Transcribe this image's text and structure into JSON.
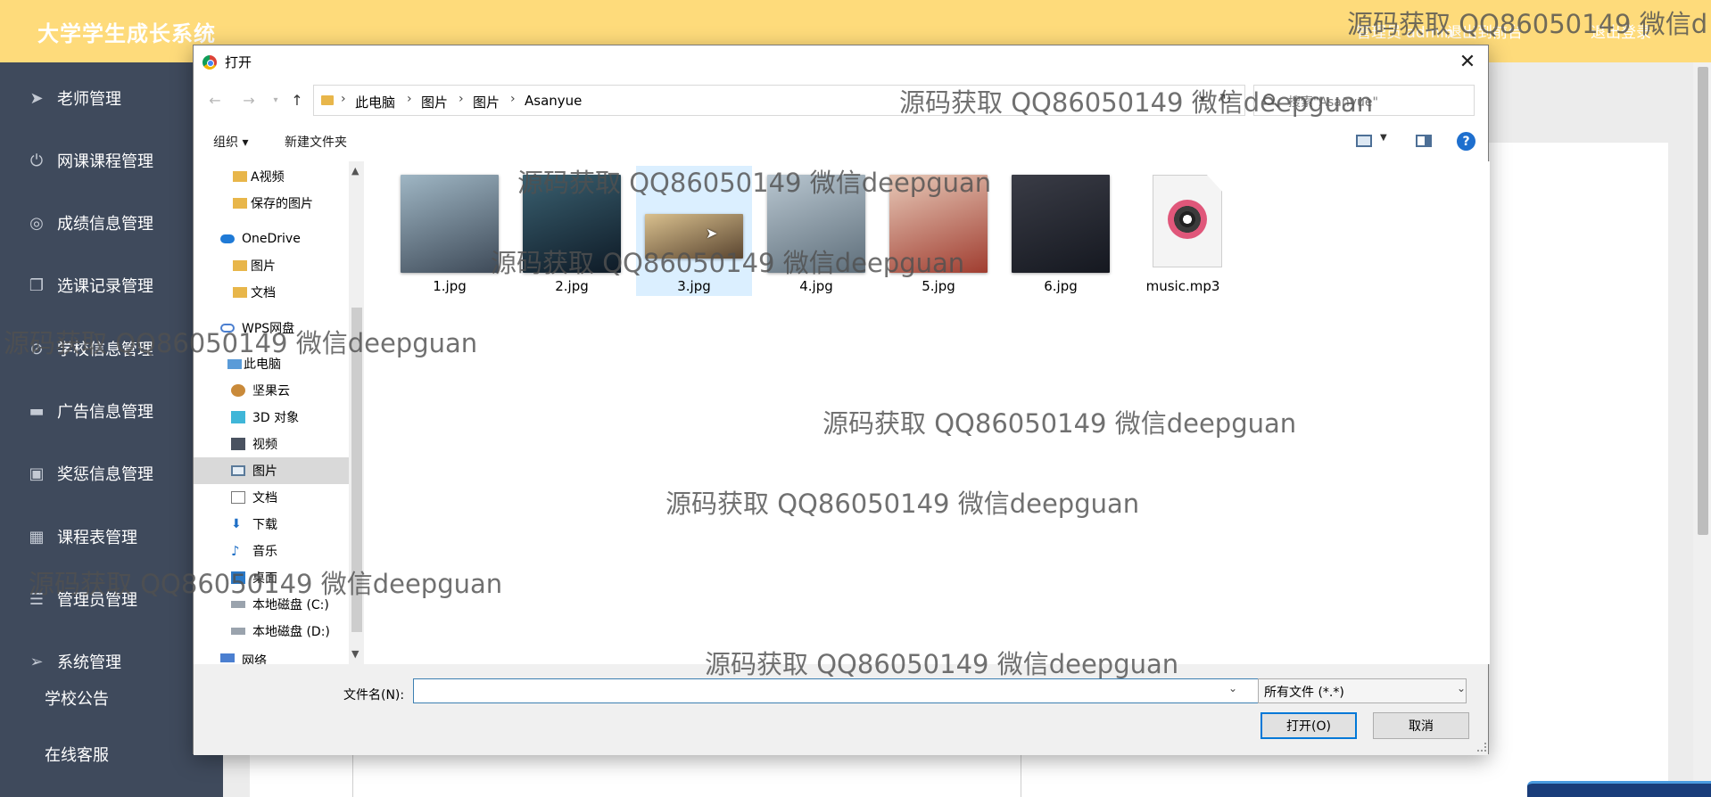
{
  "app": {
    "title": "大学学生成长系统",
    "top_links": [
      "管理员 admin",
      "退出到前台",
      "退出登录"
    ]
  },
  "sidebar": {
    "items": [
      {
        "label": "老师管理",
        "icon": "send-icon"
      },
      {
        "label": "网课课程管理",
        "icon": "power-icon"
      },
      {
        "label": "成绩信息管理",
        "icon": "target-icon"
      },
      {
        "label": "选课记录管理",
        "icon": "copy-icon"
      },
      {
        "label": "学校信息管理",
        "icon": "block-icon"
      },
      {
        "label": "广告信息管理",
        "icon": "monitor-icon"
      },
      {
        "label": "奖惩信息管理",
        "icon": "trash-icon"
      },
      {
        "label": "课程表管理",
        "icon": "grid-icon"
      },
      {
        "label": "管理员管理",
        "icon": "list-icon"
      },
      {
        "label": "系统管理",
        "icon": "navigation-icon"
      }
    ],
    "sub_items": [
      "学校公告",
      "在线客服"
    ]
  },
  "dialog": {
    "title": "打开",
    "breadcrumbs": [
      "此电脑",
      "图片",
      "图片",
      "Asanyue"
    ],
    "search_placeholder": "搜索\"Asanyue\"",
    "organize_label": "组织 ▾",
    "new_folder_label": "新建文件夹",
    "help_label": "?",
    "nav_items": [
      {
        "label": "A视频",
        "icon": "folder-icon"
      },
      {
        "label": "保存的图片",
        "icon": "folder-icon"
      },
      {
        "label": "OneDrive",
        "icon": "cloud-icon"
      },
      {
        "label": "图片",
        "icon": "folder-icon"
      },
      {
        "label": "文档",
        "icon": "folder-icon"
      },
      {
        "label": "WPS网盘",
        "icon": "cloud-icon"
      },
      {
        "label": "此电脑",
        "icon": "computer-icon"
      },
      {
        "label": "坚果云",
        "icon": "nut-icon"
      },
      {
        "label": "3D 对象",
        "icon": "cube-icon"
      },
      {
        "label": "视频",
        "icon": "film-icon"
      },
      {
        "label": "图片",
        "icon": "picture-icon"
      },
      {
        "label": "文档",
        "icon": "document-icon"
      },
      {
        "label": "下载",
        "icon": "download-icon"
      },
      {
        "label": "音乐",
        "icon": "music-note-icon"
      },
      {
        "label": "桌面",
        "icon": "desktop-icon"
      },
      {
        "label": "本地磁盘 (C:)",
        "icon": "drive-icon"
      },
      {
        "label": "本地磁盘 (D:)",
        "icon": "drive-icon"
      },
      {
        "label": "网络",
        "icon": "network-icon"
      }
    ],
    "selected_nav": "图片",
    "files": [
      {
        "name": "1.jpg",
        "colors": [
          "#9fb6c4",
          "#3e4a58"
        ]
      },
      {
        "name": "2.jpg",
        "colors": [
          "#3a6070",
          "#0e1a26"
        ]
      },
      {
        "name": "3.jpg",
        "colors": [
          "#d9c08e",
          "#5a4530"
        ]
      },
      {
        "name": "4.jpg",
        "colors": [
          "#b8c6d0",
          "#5e6e7a"
        ]
      },
      {
        "name": "5.jpg",
        "colors": [
          "#e7c9b8",
          "#a03d30"
        ]
      },
      {
        "name": "6.jpg",
        "colors": [
          "#3a3c46",
          "#151820"
        ]
      },
      {
        "name": "music.mp3",
        "colors": [
          "#f2f2f2",
          "#f2f2f2"
        ]
      }
    ],
    "selected_file": "3.jpg",
    "filename_label": "文件名(N):",
    "filename_value": "",
    "filter_value": "所有文件 (*.*)",
    "open_label": "打开(O)",
    "cancel_label": "取消"
  },
  "watermark_text": "源码获取 QQ86050149 微信deepguan",
  "watermark_partial": "源码获取 QQ86050149 微信d",
  "colors": {
    "header": "#fedb7b",
    "sidebar": "#3f4a5c",
    "accent": "#0078d7",
    "selection": "#cce8ff"
  }
}
